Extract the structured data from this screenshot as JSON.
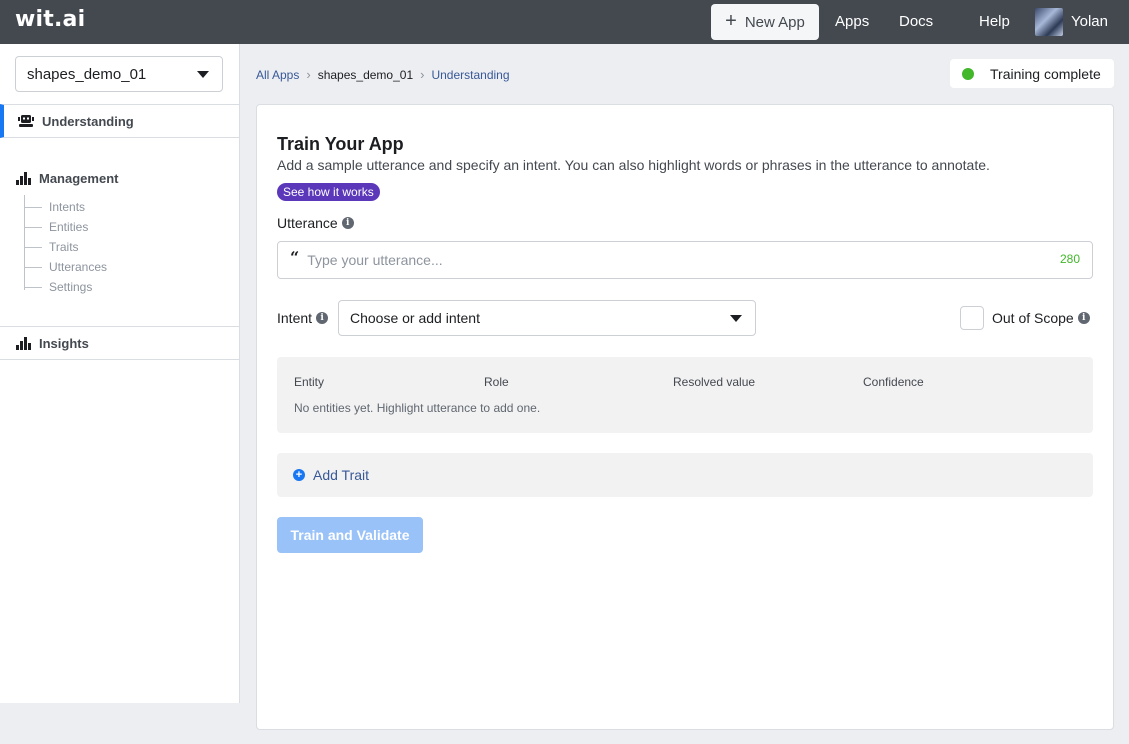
{
  "topbar": {
    "logo": "wit.ai",
    "new_app_label": "New App",
    "nav": [
      "Apps",
      "Docs",
      "Help"
    ],
    "user_name": "Yolan"
  },
  "sidebar": {
    "app_selected": "shapes_demo_01",
    "understanding": "Understanding",
    "management": "Management",
    "management_items": [
      "Intents",
      "Entities",
      "Traits",
      "Utterances",
      "Settings"
    ],
    "insights": "Insights"
  },
  "breadcrumb": {
    "all_apps": "All Apps",
    "app": "shapes_demo_01",
    "current": "Understanding"
  },
  "status": {
    "text": "Training complete",
    "color": "#42b72a"
  },
  "train": {
    "title": "Train Your App",
    "description": "Add a sample utterance and specify an intent. You can also highlight words or phrases in the utterance to annotate.",
    "how_badge": "See how it works",
    "utterance_label": "Utterance",
    "utterance_placeholder": "Type your utterance...",
    "utterance_counter": "280",
    "intent_label": "Intent",
    "intent_placeholder": "Choose or add intent",
    "out_of_scope_label": "Out of Scope",
    "entity_columns": [
      "Entity",
      "Role",
      "Resolved value",
      "Confidence"
    ],
    "entity_empty": "No entities yet. Highlight utterance to add one.",
    "add_trait_label": "Add Trait",
    "train_button": "Train and Validate"
  },
  "colors": {
    "topbar": "#444950",
    "accent": "#1877f2",
    "badge": "#5b37b9",
    "train_button_disabled": "#99c2f8"
  }
}
